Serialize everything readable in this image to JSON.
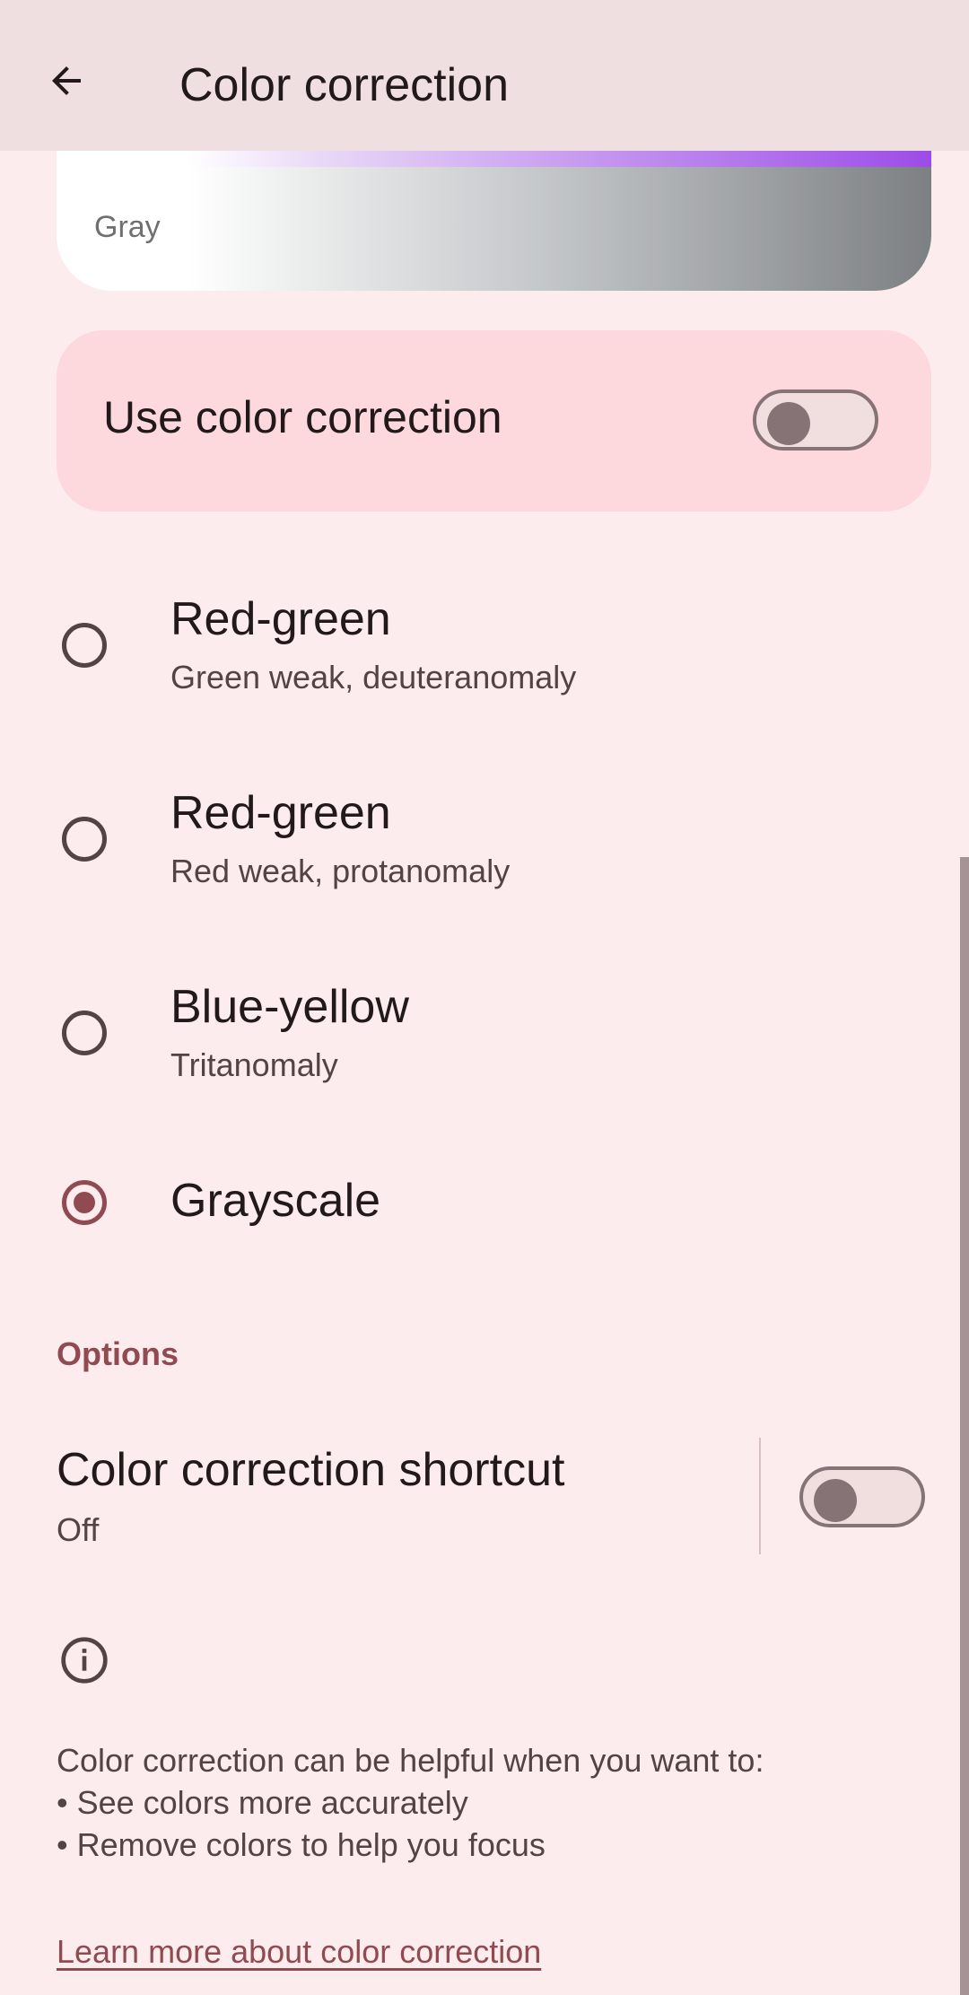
{
  "app_bar": {
    "title": "Color correction",
    "back_icon": "arrow-back-icon"
  },
  "preview": {
    "label": "Gray"
  },
  "master_switch": {
    "label": "Use color correction",
    "state": "off"
  },
  "modes": [
    {
      "title": "Red-green",
      "subtitle": "Green weak, deuteranomaly",
      "selected": false
    },
    {
      "title": "Red-green",
      "subtitle": "Red weak, protanomaly",
      "selected": false
    },
    {
      "title": "Blue-yellow",
      "subtitle": "Tritanomaly",
      "selected": false
    },
    {
      "title": "Grayscale",
      "subtitle": "",
      "selected": true
    }
  ],
  "options": {
    "header": "Options",
    "shortcut_title": "Color correction shortcut",
    "shortcut_status": "Off",
    "shortcut_state": "off"
  },
  "footer": {
    "info_icon": "info-icon",
    "text": "Color correction can be helpful when you want to:\n• See colors more accurately\n• Remove colors to help you focus",
    "link": "Learn more about color correction"
  },
  "colors": {
    "background": "#fdeced",
    "app_bar": "#efdfe0",
    "accent": "#904a51",
    "card": "#fdd8dc"
  }
}
